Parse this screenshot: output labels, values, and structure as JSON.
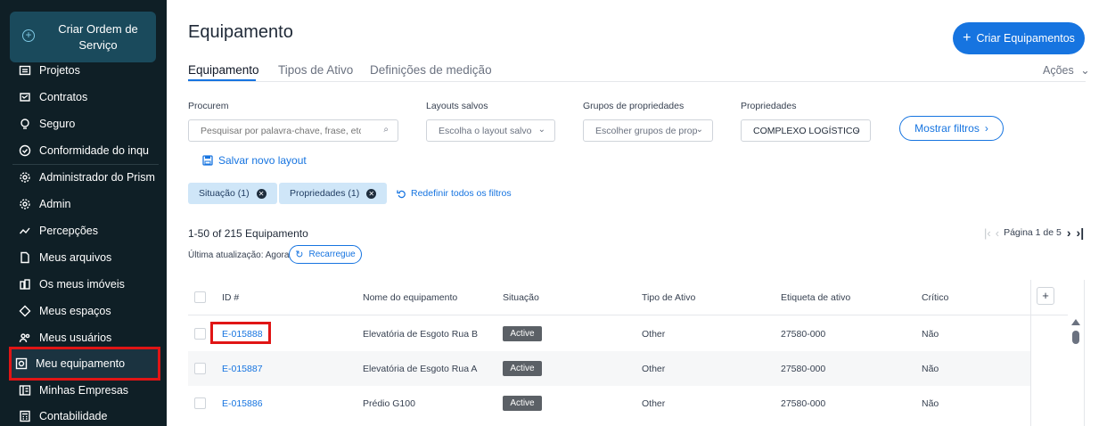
{
  "sidebar": {
    "create_order": "Criar Ordem de Serviço",
    "items": [
      {
        "label": "Projetos",
        "icon": "projects-icon"
      },
      {
        "label": "Contratos",
        "icon": "contracts-icon"
      },
      {
        "label": "Seguro",
        "icon": "insurance-icon"
      },
      {
        "label": "Conformidade do inqu",
        "icon": "compliance-icon"
      },
      {
        "label": "Administrador do Prism",
        "icon": "gear-icon"
      },
      {
        "label": "Admin",
        "icon": "gear-icon"
      },
      {
        "label": "Percepções",
        "icon": "insights-icon"
      },
      {
        "label": "Meus arquivos",
        "icon": "file-icon"
      },
      {
        "label": "Os meus imóveis",
        "icon": "buildings-icon"
      },
      {
        "label": "Meus espaços",
        "icon": "diamond-icon"
      },
      {
        "label": "Meus usuários",
        "icon": "users-icon"
      },
      {
        "label": "Meu equipamento",
        "icon": "equipment-icon"
      },
      {
        "label": "Minhas Empresas",
        "icon": "company-icon"
      },
      {
        "label": "Contabilidade",
        "icon": "calculator-icon"
      }
    ]
  },
  "header": {
    "title": "Equipamento",
    "create_button": "Criar Equipamentos",
    "actions": "Ações"
  },
  "tabs": [
    {
      "label": "Equipamento"
    },
    {
      "label": "Tipos de Ativo"
    },
    {
      "label": "Definições de medição"
    }
  ],
  "filters": {
    "search_label": "Procurem",
    "search_placeholder": "Pesquisar por palavra-chave, frase, etc...",
    "layouts_label": "Layouts salvos",
    "layouts_value": "Escolha o layout salvo",
    "groups_label": "Grupos de propriedades",
    "groups_value": "Escolher grupos de prop",
    "props_label": "Propriedades",
    "props_value": "COMPLEXO LOGÍSTICO",
    "show_filters": "Mostrar filtros",
    "save_layout": "Salvar novo layout",
    "chip_status": "Situação (1)",
    "chip_props": "Propriedades (1)",
    "reset": "Redefinir todos os filtros"
  },
  "listing": {
    "count": "1-50 of 215 Equipamento",
    "updated": "Última atualização: Agora",
    "reload": "Recarregue",
    "page": "Página 1 de 5"
  },
  "table": {
    "columns": [
      "ID #",
      "Nome do equipamento",
      "Situação",
      "Tipo de Ativo",
      "Etiqueta de ativo",
      "Crítico"
    ],
    "rows": [
      {
        "id": "E-015888",
        "name": "Elevatória de Esgoto Rua B",
        "status": "Active",
        "type": "Other",
        "tag": "27580-000",
        "critical": "Não"
      },
      {
        "id": "E-015887",
        "name": "Elevatória de Esgoto Rua A",
        "status": "Active",
        "type": "Other",
        "tag": "27580-000",
        "critical": "Não"
      },
      {
        "id": "E-015886",
        "name": "Prédio G100",
        "status": "Active",
        "type": "Other",
        "tag": "27580-000",
        "critical": "Não"
      }
    ]
  },
  "colors": {
    "accent": "#1674e0",
    "sidebar_bg": "#0f1f26",
    "highlight": "#e01515"
  }
}
